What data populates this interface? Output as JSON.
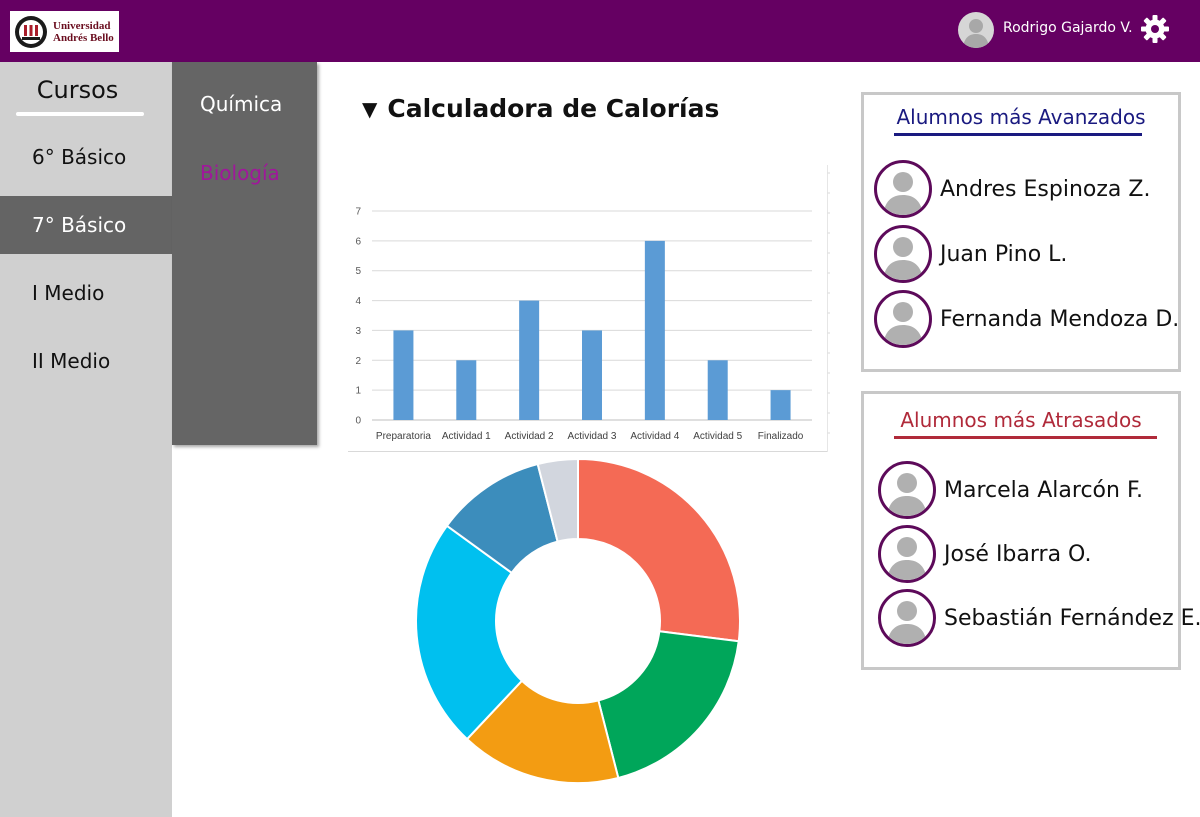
{
  "header": {
    "logo_line1": "Universidad",
    "logo_line2": "Andrés Bello",
    "user_name": "Rodrigo Gajardo V.",
    "brand_color": "#650062",
    "icons": {
      "settings": "gear-icon",
      "avatar": "user-avatar-icon"
    }
  },
  "sidebar": {
    "title": "Cursos",
    "items": [
      {
        "label": "6° Básico",
        "active": false
      },
      {
        "label": "7° Básico",
        "active": true
      },
      {
        "label": "I Medio",
        "active": false
      },
      {
        "label": "II Medio",
        "active": false
      }
    ]
  },
  "subjects": {
    "items": [
      {
        "label": "Química",
        "color": "#ffffff"
      },
      {
        "label": "Biología",
        "color": "#a0179b"
      }
    ]
  },
  "main": {
    "title": "Calculadora de Calorías"
  },
  "chart_data": [
    {
      "type": "bar",
      "categories": [
        "Preparatoria",
        "Actividad 1",
        "Actividad 2",
        "Actividad 3",
        "Actividad 4",
        "Actividad 5",
        "Finalizado"
      ],
      "values": [
        3,
        2,
        4,
        3,
        6,
        2,
        1
      ],
      "ylim": [
        0,
        7
      ],
      "yticks": [
        "0",
        "1",
        "2",
        "3",
        "4",
        "5",
        "6",
        "7"
      ],
      "grid": true,
      "bar_color": "#5b9bd5"
    },
    {
      "type": "pie",
      "donut": true,
      "values": [
        27,
        19,
        16,
        23,
        11,
        4
      ],
      "colors": [
        "#f46a55",
        "#00a65a",
        "#f39c12",
        "#00c0ef",
        "#3c8dbc",
        "#d2d6de"
      ]
    }
  ],
  "advanced": {
    "title": "Alumnos más Avanzados",
    "title_color": "#1a1a80",
    "students": [
      "Andres Espinoza Z.",
      "Juan Pino L.",
      "Fernanda Mendoza D."
    ]
  },
  "behind": {
    "title": "Alumnos más Atrasados",
    "title_color": "#b02a3a",
    "students": [
      "Marcela Alarcón F.",
      "José Ibarra O.",
      "Sebastián Fernández E."
    ]
  }
}
